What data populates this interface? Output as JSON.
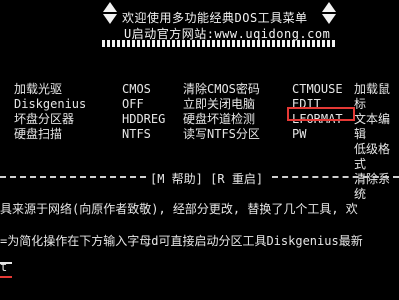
{
  "banner": {
    "title_line": "欢迎使用多功能经典DOS工具菜单",
    "site_line": "U启动官方网站:www.uqidong.com"
  },
  "menu": {
    "col1": [
      "加载光驱",
      "Diskgenius",
      "坏盘分区器",
      "硬盘扫描"
    ],
    "col2": [
      "CMOS",
      "OFF",
      "HDDREG",
      "NTFS"
    ],
    "col3": [
      "清除CMOS密码",
      "立即关闭电脑",
      "硬盘坏道检测",
      "读写NTFS分区"
    ],
    "col4": [
      "CTMOUSE",
      "EDIT",
      "LFORMAT",
      "PW"
    ],
    "col5": [
      "加载鼠标",
      "文本编辑",
      "低级格式",
      "清除系统"
    ],
    "highlighted_item": "LFORMAT"
  },
  "help_bar": {
    "help": "[M 帮助]",
    "restart": "[R 重启]"
  },
  "info": {
    "line1": "具来源于网络(向原作者致敬), 经部分更改, 替换了几个工具, 欢",
    "line2": "=为简化操作在下方输入字母d可直接启动分区工具Diskgenius最新",
    "prompt": "t"
  }
}
